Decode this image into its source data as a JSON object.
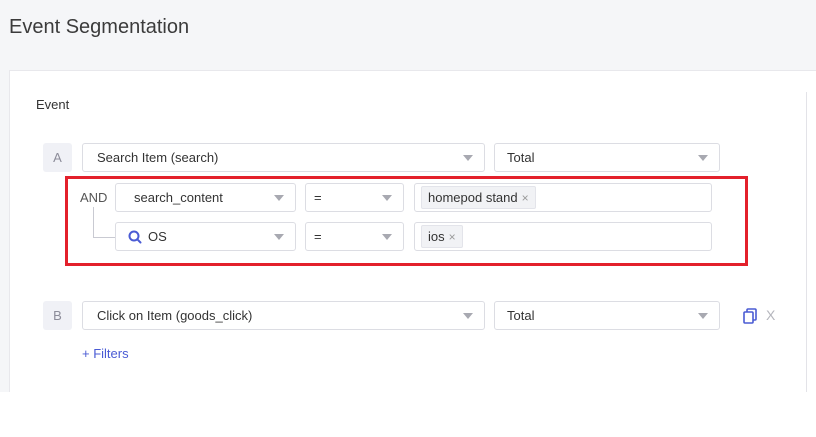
{
  "page": {
    "title": "Event Segmentation"
  },
  "event_section": {
    "label": "Event"
  },
  "event_a": {
    "letter": "A",
    "event_select": "Search Item (search)",
    "measure_select": "Total",
    "filter_join": "AND",
    "filters": [
      {
        "property": "search_content",
        "operator": "=",
        "values": [
          "homepod stand"
        ],
        "property_icon": ""
      },
      {
        "property": "OS",
        "operator": "=",
        "values": [
          "ios"
        ],
        "property_icon": "search-icon"
      }
    ]
  },
  "event_b": {
    "letter": "B",
    "event_select": "Click on Item (goods_click)",
    "measure_select": "Total",
    "add_filters_label": "+ Filters",
    "delete_label": "X"
  },
  "colors": {
    "accent": "#4a5bd4",
    "highlight_box": "#e3202b"
  },
  "icons": {
    "remove_tag": "×"
  }
}
